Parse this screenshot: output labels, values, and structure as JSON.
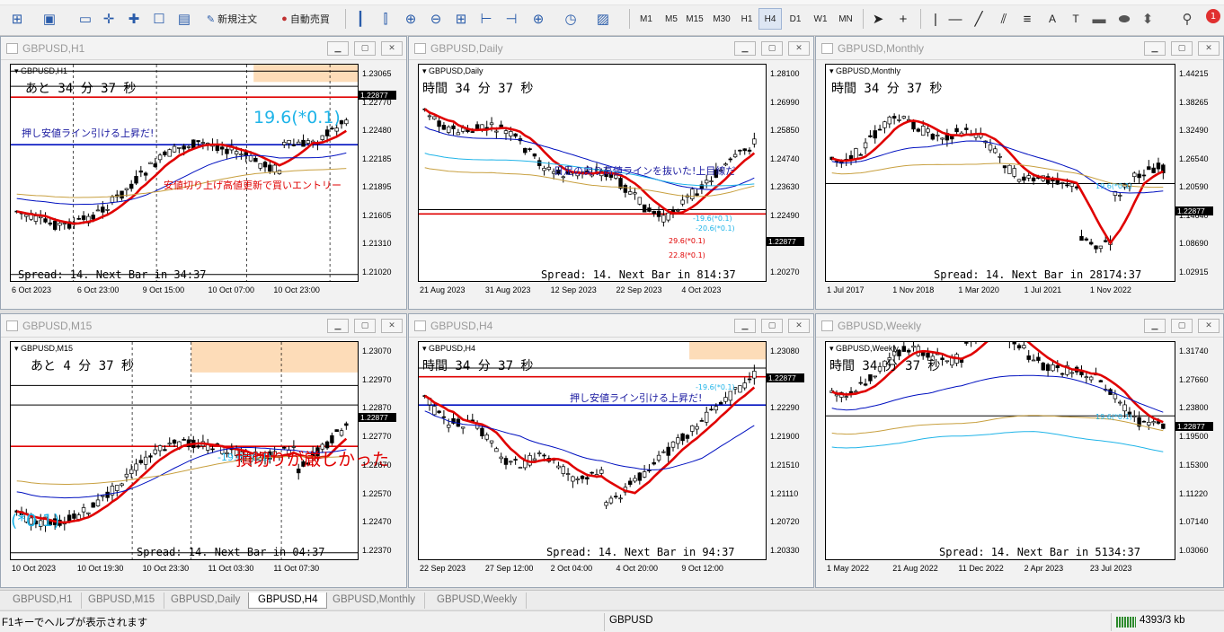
{
  "toolbar": {
    "new_order": "新規注文",
    "auto_trade": "自動売買",
    "timeframes": [
      "M1",
      "M5",
      "M15",
      "M30",
      "H1",
      "H4",
      "D1",
      "W1",
      "MN"
    ],
    "active_timeframe": "H4",
    "notification_count": "1"
  },
  "windows": [
    {
      "title": "GBPUSD,H1",
      "symbol": "GBPUSD,H1",
      "timer": "あと 34 分 37 秒",
      "spread": "Spread: 14. Next Bar in 34:37",
      "price_tag": "1.22877",
      "yticks": [
        "1.23065",
        "1.22770",
        "1.22480",
        "1.22185",
        "1.21895",
        "1.21605",
        "1.21310",
        "1.21020"
      ],
      "xticks": [
        "6 Oct 2023",
        "6 Oct 23:00",
        "9 Oct 15:00",
        "10 Oct 07:00",
        "10 Oct 23:00"
      ],
      "annotations": [
        {
          "text": "押し安値ライン引ける上昇だ!",
          "color": "#1a1aa0"
        },
        {
          "text": "19.6(*0.1)",
          "color": "#1fb4e8"
        },
        {
          "text": "安値切り上げ高値更新で買いエントリー",
          "color": "#e00000"
        }
      ]
    },
    {
      "title": "GBPUSD,Daily",
      "symbol": "GBPUSD,Daily",
      "timer": "時間 34 分 37 秒",
      "spread": "Spread: 14. Next Bar in 814:37",
      "price_tag": "1.22877",
      "yticks": [
        "1.28100",
        "1.26990",
        "1.25850",
        "1.24740",
        "1.23630",
        "1.22490",
        "1.21380",
        "1.20270"
      ],
      "xticks": [
        "21 Aug 2023",
        "31 Aug 2023",
        "12 Sep 2023",
        "22 Sep 2023",
        "4 Oct 2023"
      ],
      "annotations": [
        {
          "text": "日足の戻り高値ラインを抜いた!上目線だ",
          "color": "#1a1aa0"
        },
        {
          "text": "-19.6(*0.1)",
          "color": "#1fb4e8"
        },
        {
          "text": "-20.6(*0.1)",
          "color": "#1fb4e8"
        },
        {
          "text": "29.6(*0.1)",
          "color": "#e00000"
        },
        {
          "text": "22.8(*0.1)",
          "color": "#e00000"
        }
      ]
    },
    {
      "title": "GBPUSD,Monthly",
      "symbol": "GBPUSD,Monthly",
      "timer": "時間 34 分 37 秒",
      "spread": "Spread: 14. Next Bar in 28174:37",
      "price_tag": "1.22877",
      "yticks": [
        "1.44215",
        "1.38265",
        "1.32490",
        "1.26540",
        "1.20590",
        "1.14640",
        "1.08690",
        "1.02915"
      ],
      "xticks": [
        "1 Jul 2017",
        "1 Nov 2018",
        "1 Mar 2020",
        "1 Jul 2021",
        "1 Nov 2022"
      ],
      "annotations": [
        {
          "text": "19.6(*0.1)",
          "color": "#1fb4e8"
        }
      ]
    },
    {
      "title": "GBPUSD,M15",
      "symbol": "GBPUSD,M15",
      "timer": "あと 4 分 37 秒",
      "spread": "Spread: 14. Next Bar in 04:37",
      "price_tag": "1.22877",
      "yticks": [
        "1.23070",
        "1.22970",
        "1.22870",
        "1.22770",
        "1.22670",
        "1.22570",
        "1.22470",
        "1.22370"
      ],
      "xticks": [
        "10 Oct 2023",
        "10 Oct 19:30",
        "10 Oct 23:30",
        "11 Oct 03:30",
        "11 Oct 07:30"
      ],
      "annotations": [
        {
          "text": "-19.6(*0.1)",
          "color": "#1fb4e8"
        },
        {
          "text": "損切りが厳しかった",
          "color": "#e00000"
        },
        {
          "text": "(*0.1)",
          "color": "#1fb4e8"
        }
      ]
    },
    {
      "title": "GBPUSD,H4",
      "symbol": "GBPUSD,H4",
      "timer": "時間 34 分 37 秒",
      "spread": "Spread: 14. Next Bar in 94:37",
      "price_tag": "1.22877",
      "yticks": [
        "1.23080",
        "1.22690",
        "1.22290",
        "1.21900",
        "1.21510",
        "1.21110",
        "1.20720",
        "1.20330"
      ],
      "xticks": [
        "22 Sep 2023",
        "27 Sep 12:00",
        "2 Oct 04:00",
        "4 Oct 20:00",
        "9 Oct 12:00"
      ],
      "annotations": [
        {
          "text": "押し安値ライン引ける上昇だ!",
          "color": "#1a1aa0"
        },
        {
          "text": "-19.6(*0.1)",
          "color": "#1fb4e8"
        }
      ]
    },
    {
      "title": "GBPUSD,Weekly",
      "symbol": "GBPUSD,Weekly",
      "timer": "時間 34 分 37 秒",
      "spread": "Spread: 14. Next Bar in 5134:37",
      "price_tag": "1.22877",
      "yticks": [
        "1.31740",
        "1.27660",
        "1.23800",
        "1.19500",
        "1.15300",
        "1.11220",
        "1.07140",
        "1.03060"
      ],
      "xticks": [
        "1 May 2022",
        "21 Aug 2022",
        "11 Dec 2022",
        "2 Apr 2023",
        "23 Jul 2023"
      ],
      "annotations": [
        {
          "text": "19.6(*0.1)",
          "color": "#1fb4e8"
        }
      ]
    }
  ],
  "tabs": [
    "GBPUSD,H1",
    "GBPUSD,M15",
    "GBPUSD,Daily",
    "GBPUSD,H4",
    "GBPUSD,Monthly",
    "GBPUSD,Weekly"
  ],
  "active_tab": "GBPUSD,H4",
  "status": {
    "help": "F1キーでヘルプが表示されます",
    "symbol": "GBPUSD",
    "traffic": "4393/3 kb"
  }
}
